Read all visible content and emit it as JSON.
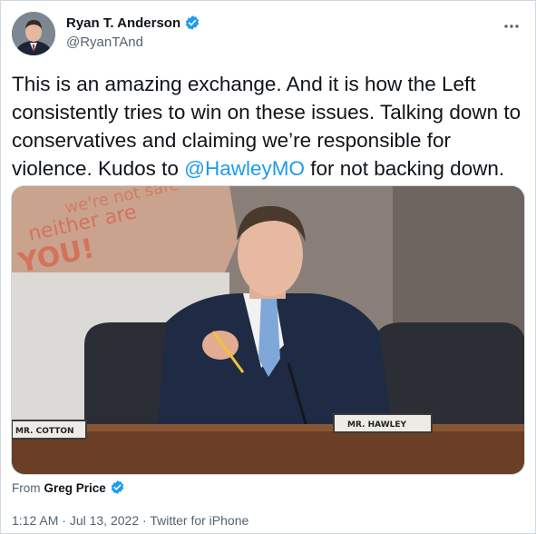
{
  "author": {
    "display_name": "Ryan T. Anderson",
    "handle": "@RyanTAnd",
    "verified_icon": "verified-badge-icon"
  },
  "tweet": {
    "text_before": "This is an amazing exchange. And it is how the Left consistently tries to win on these issues. Talking down to conservatives and claiming we’re responsible for violence. Kudos to ",
    "mention": "@HawleyMO",
    "text_after": " for not backing down."
  },
  "media": {
    "nameplate_left": "MR. COTTON",
    "nameplate_right": "MR. HAWLEY",
    "sign_text_1": "neither are",
    "sign_text_2": "YOU!"
  },
  "attribution": {
    "prefix": "From",
    "name": "Greg Price"
  },
  "meta": {
    "time": "1:12 AM",
    "date": "Jul 13, 2022",
    "source": "Twitter for iPhone",
    "separator": " · "
  },
  "colors": {
    "accent": "#1d9bf0",
    "text": "#0f1419",
    "muted": "#536471"
  }
}
